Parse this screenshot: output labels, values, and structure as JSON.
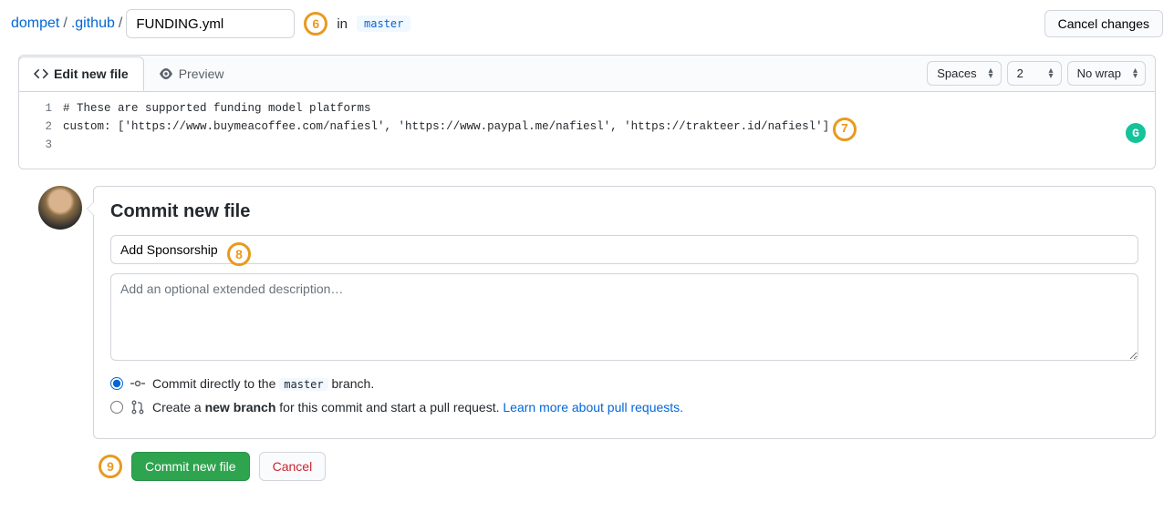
{
  "breadcrumb": {
    "repo": "dompet",
    "folder": ".github",
    "filename": "FUNDING.yml",
    "in_text": "in",
    "branch": "master"
  },
  "buttons": {
    "cancel_changes": "Cancel changes",
    "commit_file": "Commit new file",
    "cancel": "Cancel"
  },
  "tabs": {
    "edit": "Edit new file",
    "preview": "Preview"
  },
  "editor_opts": {
    "indent_mode": "Spaces",
    "indent_size": "2",
    "wrap_mode": "No wrap"
  },
  "code": {
    "line1_num": "1",
    "line2_num": "2",
    "line3_num": "3",
    "line1": "# These are supported funding model platforms",
    "line2": "",
    "line3": "custom: ['https://www.buymeacoffee.com/nafiesl', 'https://www.paypal.me/nafiesl', 'https://trakteer.id/nafiesl']"
  },
  "commit": {
    "heading": "Commit new file",
    "summary_value": "Add Sponsorship",
    "desc_placeholder": "Add an optional extended description…",
    "radio1_pre": "Commit directly to the ",
    "radio1_branch": "master",
    "radio1_post": " branch.",
    "radio2_pre": "Create a ",
    "radio2_bold": "new branch",
    "radio2_mid": " for this commit and start a pull request. ",
    "radio2_link": "Learn more about pull requests."
  },
  "annotations": {
    "a6": "6",
    "a7": "7",
    "a8": "8",
    "a9": "9"
  },
  "grammarly": "G"
}
